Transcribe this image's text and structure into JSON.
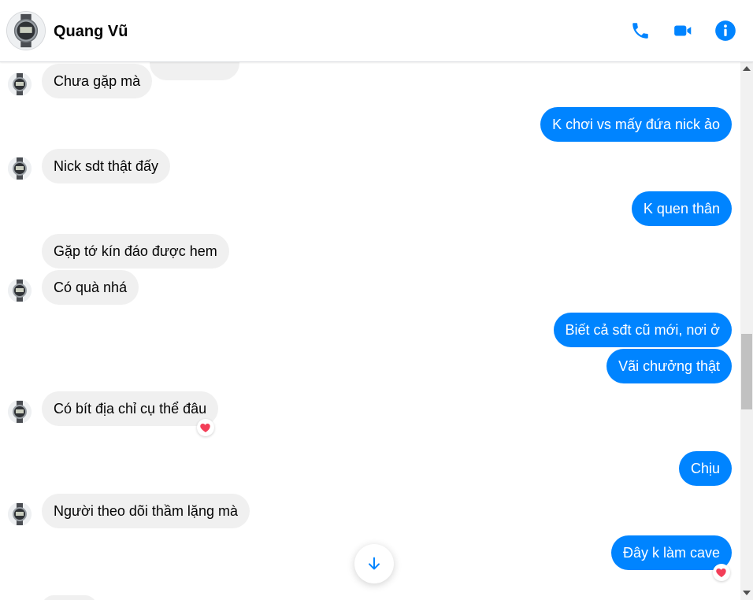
{
  "header": {
    "contact_name": "Quang Vũ",
    "icons": [
      "phone-icon",
      "video-camera-icon",
      "info-icon"
    ],
    "accent_color": "#0084ff"
  },
  "messages": [
    {
      "side": "incoming",
      "text": "Chưa gặp mà"
    },
    {
      "side": "outgoing",
      "text": "K chơi vs mấy đứa nick ảo"
    },
    {
      "side": "incoming",
      "text": "Nick sdt thật đấy"
    },
    {
      "side": "outgoing",
      "text": "K quen thân"
    },
    {
      "side": "incoming",
      "text": "Gặp tớ kín đáo được hem"
    },
    {
      "side": "incoming",
      "text": "Có quà nhá"
    },
    {
      "side": "outgoing",
      "text": "Biết cả sđt cũ mới, nơi ở"
    },
    {
      "side": "outgoing",
      "text": "Vãi chưởng thật"
    },
    {
      "side": "incoming",
      "text": "Có bít địa chỉ cụ thể đâu",
      "reaction": "heart"
    },
    {
      "side": "outgoing",
      "text": "Chịu"
    },
    {
      "side": "incoming",
      "text": "Người theo dõi thầm lặng mà"
    },
    {
      "side": "outgoing",
      "text": "Đây k làm cave",
      "reaction": "heart"
    }
  ],
  "colors": {
    "outgoing_bubble": "#0084ff",
    "incoming_bubble": "#f0f0f0",
    "reaction_heart": "#f33e58"
  }
}
